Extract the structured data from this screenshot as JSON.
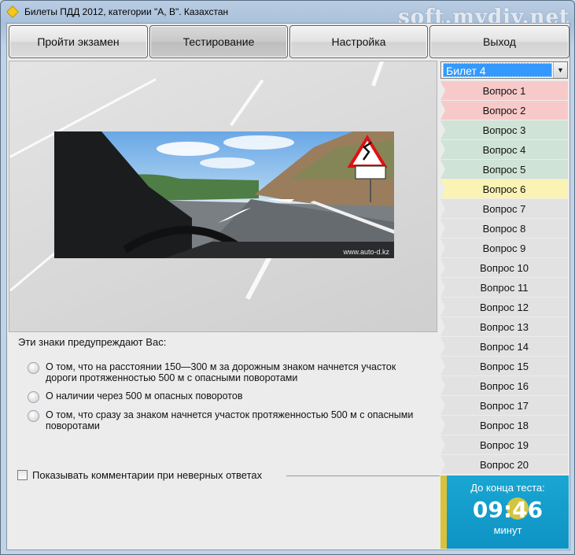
{
  "window": {
    "title": "Билеты ПДД 2012, категории \"А, В\". Казахстан",
    "watermark": "soft.mydiv.net"
  },
  "menu": [
    {
      "label": "Пройти экзамен",
      "active": false
    },
    {
      "label": "Тестирование",
      "active": true
    },
    {
      "label": "Настройка",
      "active": false
    },
    {
      "label": "Выход",
      "active": false
    }
  ],
  "image": {
    "credit": "www.auto-d.kz"
  },
  "question": {
    "text": "Эти знаки предупреждают Вас:",
    "answers": [
      "О том, что на расстоянии 150—300 м за дорожным знаком начнется участок дороги протяженностью 500 м с опасными поворотами",
      "О наличии через 500 м опасных поворотов",
      "О том, что сразу за знаком начнется участок протяженностью 500 м с опасными поворотами"
    ]
  },
  "comments_label": "Показывать комментарии при неверных ответах",
  "ticket": {
    "selected": "Билет 4"
  },
  "questions": [
    {
      "label": "Вопрос 1",
      "color": "#f8c9c9"
    },
    {
      "label": "Вопрос 2",
      "color": "#f8c9c9"
    },
    {
      "label": "Вопрос 3",
      "color": "#cfe3d6"
    },
    {
      "label": "Вопрос 4",
      "color": "#cfe3d6"
    },
    {
      "label": "Вопрос 5",
      "color": "#cfe3d6"
    },
    {
      "label": "Вопрос 6",
      "color": "#fbf3b4"
    },
    {
      "label": "Вопрос 7",
      "color": "#e2e2e2"
    },
    {
      "label": "Вопрос 8",
      "color": "#e2e2e2"
    },
    {
      "label": "Вопрос 9",
      "color": "#e2e2e2"
    },
    {
      "label": "Вопрос 10",
      "color": "#e2e2e2"
    },
    {
      "label": "Вопрос 11",
      "color": "#e2e2e2"
    },
    {
      "label": "Вопрос 12",
      "color": "#e2e2e2"
    },
    {
      "label": "Вопрос 13",
      "color": "#e2e2e2"
    },
    {
      "label": "Вопрос 14",
      "color": "#e2e2e2"
    },
    {
      "label": "Вопрос 15",
      "color": "#e2e2e2"
    },
    {
      "label": "Вопрос 16",
      "color": "#e2e2e2"
    },
    {
      "label": "Вопрос 17",
      "color": "#e2e2e2"
    },
    {
      "label": "Вопрос 18",
      "color": "#e2e2e2"
    },
    {
      "label": "Вопрос 19",
      "color": "#e2e2e2"
    },
    {
      "label": "Вопрос 20",
      "color": "#e2e2e2"
    }
  ],
  "timer": {
    "label": "До конца теста:",
    "time": "09:46",
    "unit": "минут"
  }
}
